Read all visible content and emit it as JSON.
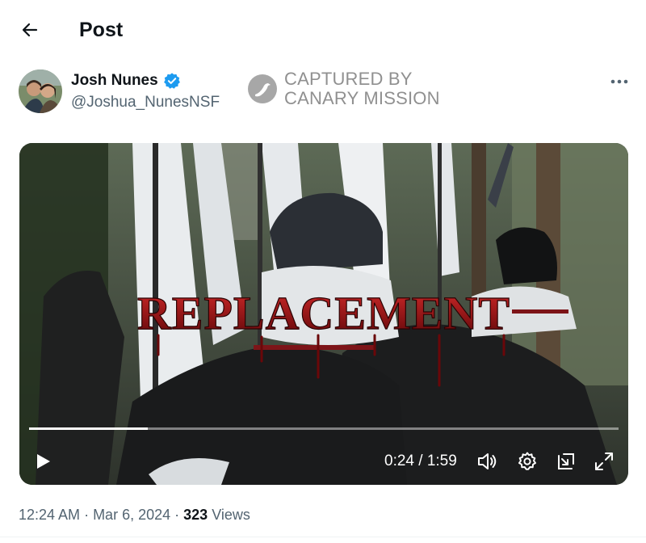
{
  "header": {
    "title": "Post"
  },
  "author": {
    "name": "Josh Nunes",
    "handle": "@Joshua_NunesNSF",
    "verified": true
  },
  "watermark": {
    "line1": "CAPTURED BY",
    "line2": "CANARY MISSION"
  },
  "video": {
    "overlay_text": "REPLACEMENT",
    "current_time": "0:24",
    "duration": "1:59",
    "time_display": "0:24 / 1:59",
    "progress": 0.2017
  },
  "meta": {
    "time": "12:24 AM",
    "separator": "·",
    "date": "Mar 6, 2024",
    "views_count": "323",
    "views_label": "Views"
  },
  "colors": {
    "verified_badge": "#1d9bf0",
    "text_secondary": "#536471",
    "overlay_red": "#8b0c10"
  },
  "icons": [
    "back-arrow-icon",
    "verified-badge-icon",
    "canary-logo-icon",
    "more-icon",
    "play-icon",
    "volume-icon",
    "settings-icon",
    "pip-icon",
    "fullscreen-icon"
  ]
}
